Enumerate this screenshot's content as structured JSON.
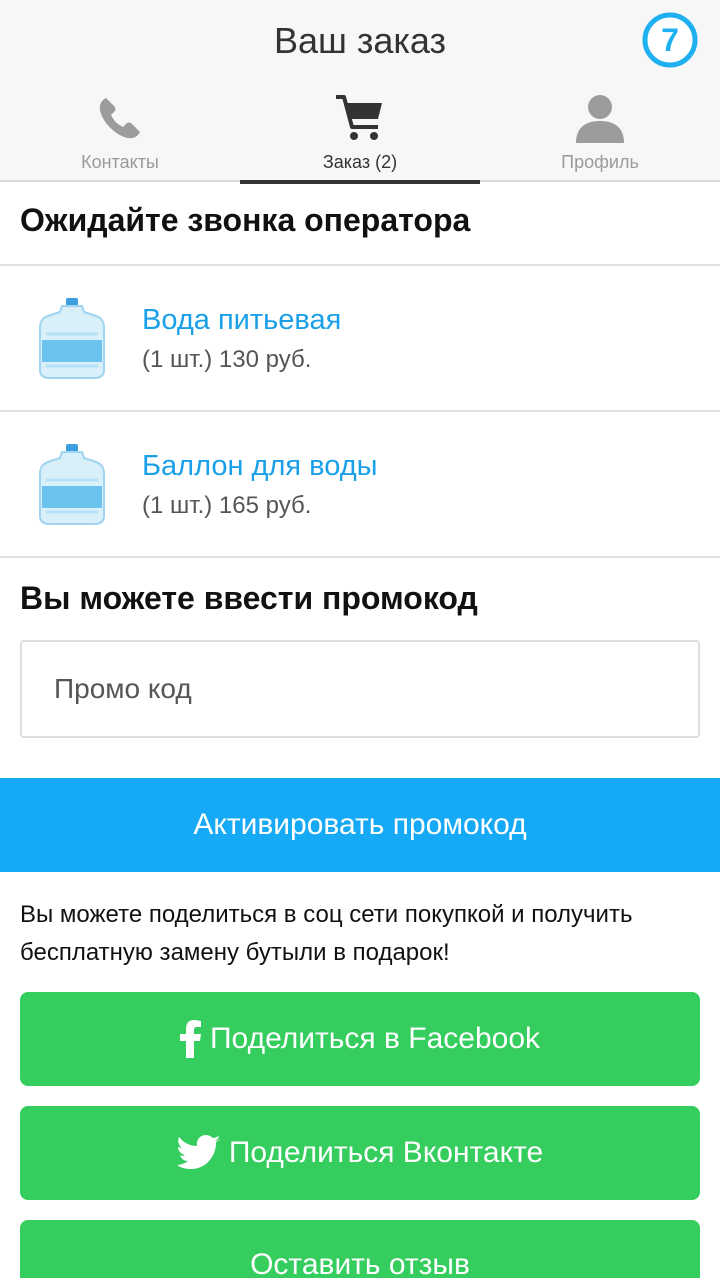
{
  "header": {
    "title": "Ваш заказ",
    "badge_number": "7",
    "tabs": [
      {
        "label": "Контакты",
        "icon": "phone-icon"
      },
      {
        "label": "Заказ (2)",
        "icon": "cart-icon",
        "active": true
      },
      {
        "label": "Профиль",
        "icon": "person-icon"
      }
    ]
  },
  "order": {
    "status": "Ожидайте звонка оператора",
    "items": [
      {
        "name": "Вода питьевая",
        "qty": "(1 шт.) 130 руб.",
        "icon": "water-bottle-icon"
      },
      {
        "name": "Баллон для воды",
        "qty": "(1 шт.) 165 руб.",
        "icon": "water-bottle-icon"
      }
    ]
  },
  "promo": {
    "title": "Вы можете ввести промокод",
    "placeholder": "Промо код",
    "activate_label": "Активировать промокод"
  },
  "share": {
    "text": "Вы можете поделиться в соц сети покупкой и получить бесплатную замену бутыли в подарок!",
    "facebook_label": "Поделиться в Facebook",
    "vk_label": "Поделиться Вконтакте",
    "review_label": "Оставить отзыв"
  },
  "colors": {
    "accent_blue": "#16a9f5",
    "link_blue": "#1aa0e8",
    "green": "#34cd5e"
  }
}
